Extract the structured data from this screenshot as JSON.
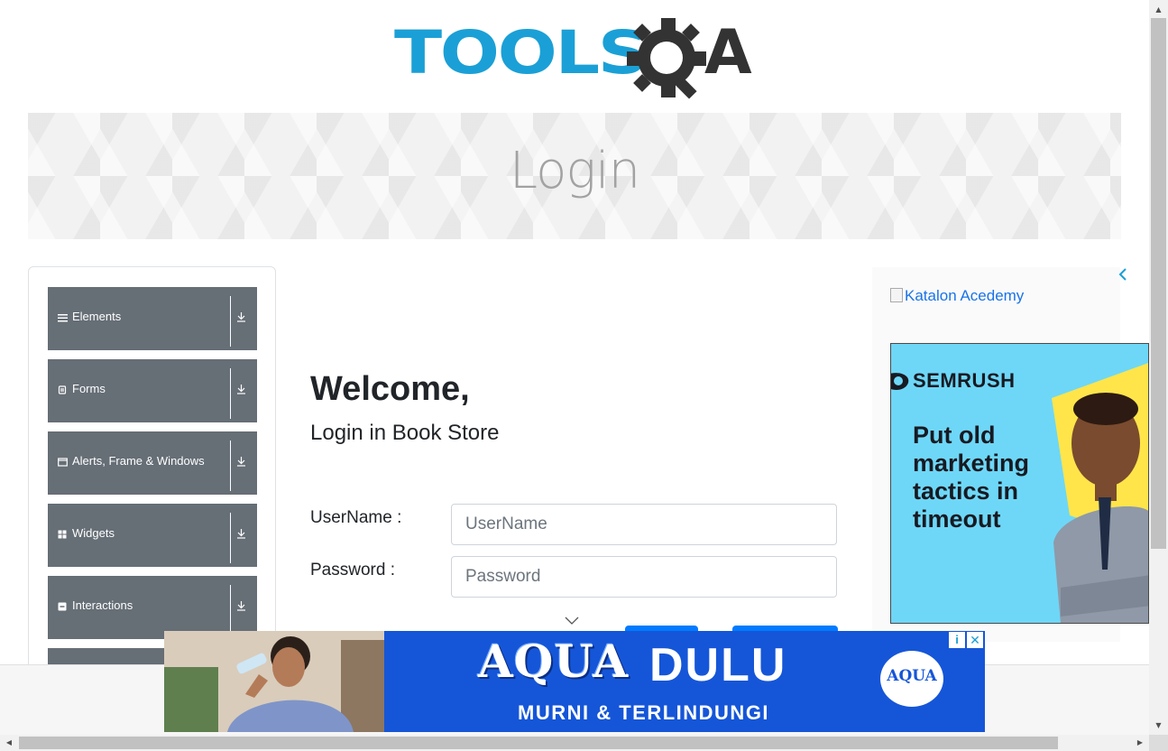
{
  "logo": {
    "tools": "TOOLS",
    "a": "A"
  },
  "banner": {
    "title": "Login"
  },
  "sidebar": {
    "groups": [
      {
        "label": "Elements",
        "icon": "menu-icon"
      },
      {
        "label": "Forms",
        "icon": "form-icon"
      },
      {
        "label": "Alerts, Frame & Windows",
        "icon": "window-icon"
      },
      {
        "label": "Widgets",
        "icon": "grid-icon"
      },
      {
        "label": "Interactions",
        "icon": "interaction-icon"
      }
    ]
  },
  "main": {
    "welcome": "Welcome,",
    "subtitle": "Login in Book Store",
    "username_label": "UserName :",
    "username_placeholder": "UserName",
    "password_label": "Password :",
    "password_placeholder": "Password"
  },
  "right_ad": {
    "katalon_alt": "Katalon Acedemy",
    "semrush_brand": "SEMRUSH",
    "semrush_text": "Put old marketing tactics in timeout"
  },
  "bottom_ad": {
    "headline": "AQUA",
    "headline2": "DULU",
    "tagline": "MURNI & TERLINDUNGI",
    "logo": "AQUA",
    "info": "i",
    "close": "✕"
  },
  "colors": {
    "brand": "#1aa0d6",
    "sidebar_bg": "#666e76",
    "primary": "#007bff"
  }
}
